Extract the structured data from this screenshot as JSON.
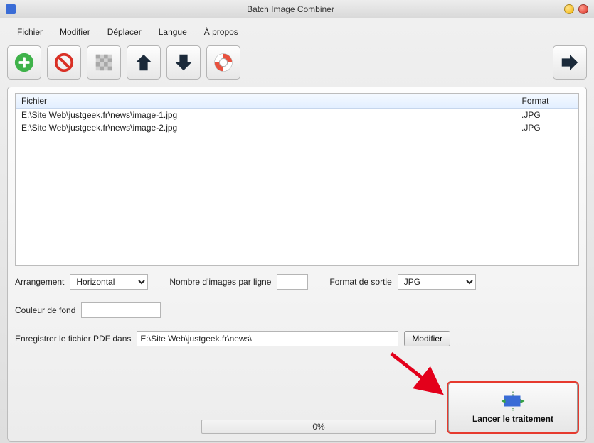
{
  "window": {
    "title": "Batch Image Combiner"
  },
  "menu": {
    "file": "Fichier",
    "edit": "Modifier",
    "move": "Déplacer",
    "lang": "Langue",
    "about": "À propos"
  },
  "table": {
    "col_file": "Fichier",
    "col_format": "Format",
    "rows": [
      {
        "path": "E:\\Site Web\\justgeek.fr\\news\\image-1.jpg",
        "fmt": ".JPG"
      },
      {
        "path": "E:\\Site Web\\justgeek.fr\\news\\image-2.jpg",
        "fmt": ".JPG"
      }
    ]
  },
  "arrangement": {
    "label": "Arrangement",
    "value": "Horizontal"
  },
  "per_line": {
    "label": "Nombre d'images par ligne",
    "value": ""
  },
  "out_format": {
    "label": "Format de sortie",
    "value": "JPG"
  },
  "bg_color": {
    "label": "Couleur de fond"
  },
  "save_pdf": {
    "label": "Enregistrer le fichier PDF dans",
    "path": "E:\\Site Web\\justgeek.fr\\news\\",
    "modify": "Modifier"
  },
  "progress": {
    "text": "0%"
  },
  "launch": {
    "label": "Lancer le traitement"
  }
}
